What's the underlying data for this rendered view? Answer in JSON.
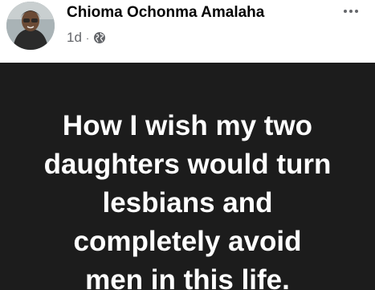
{
  "post": {
    "author": "Chioma Ochonma Amalaha",
    "timestamp": "1d",
    "separator": "·",
    "audience_icon": "globe-icon",
    "more_icon": "more-options-icon",
    "status_text": "How I wish my two\ndaughters would turn\nlesbians and\ncompletely avoid\nmen in this life.",
    "colors": {
      "card_background": "#1c1c1c",
      "status_text": "#ffffff",
      "author_text": "#050505",
      "meta_text": "#65676b"
    }
  }
}
